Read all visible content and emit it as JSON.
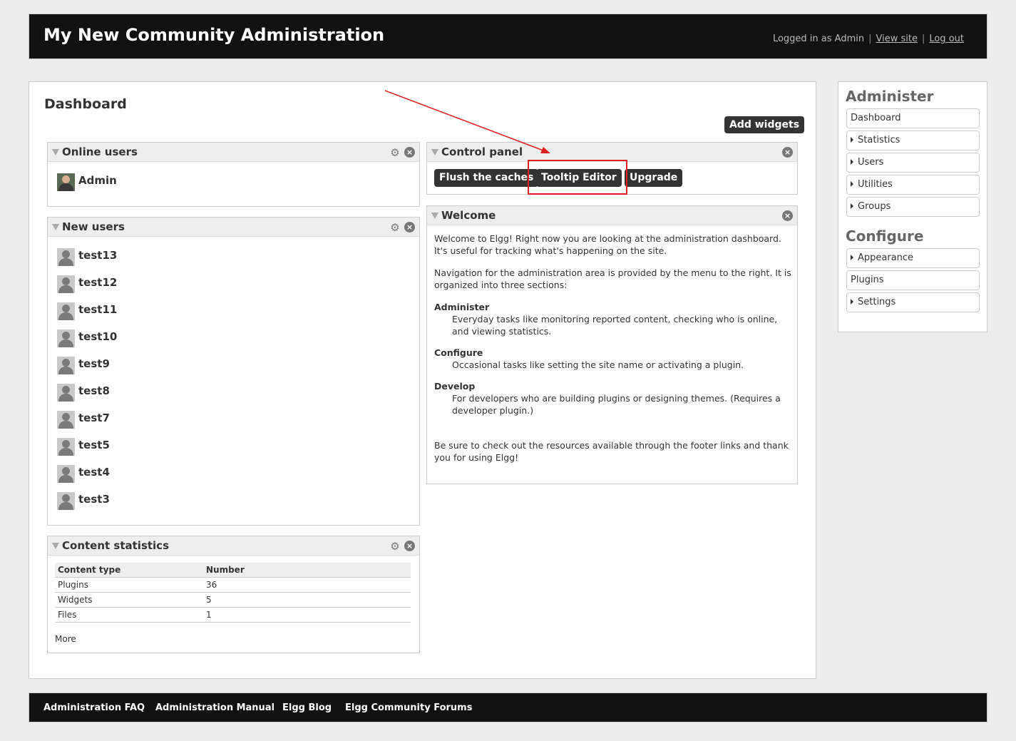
{
  "header": {
    "site_title": "My New Community Administration",
    "logged_in": "Logged in as Admin",
    "view_site": "View site",
    "log_out": "Log out"
  },
  "main": {
    "page_title": "Dashboard",
    "add_widgets": "Add widgets"
  },
  "widgets": {
    "online_users": {
      "title": "Online users",
      "users": [
        "Admin"
      ]
    },
    "new_users": {
      "title": "New users",
      "users": [
        "test13",
        "test12",
        "test11",
        "test10",
        "test9",
        "test8",
        "test7",
        "test5",
        "test4",
        "test3"
      ]
    },
    "content_statistics": {
      "title": "Content statistics",
      "headers": [
        "Content type",
        "Number"
      ],
      "rows": [
        [
          "Plugins",
          "36"
        ],
        [
          "Widgets",
          "5"
        ],
        [
          "Files",
          "1"
        ]
      ],
      "more": "More"
    },
    "control_panel": {
      "title": "Control panel",
      "buttons": [
        "Flush the caches",
        "Tooltip Editor",
        "Upgrade"
      ]
    },
    "welcome": {
      "title": "Welcome",
      "intro": "Welcome to Elgg! Right now you are looking at the administration dashboard. It's useful for tracking what's happening on the site.",
      "nav": "Navigation for the administration area is provided by the menu to the right. It is organized into three sections:",
      "sections": [
        {
          "term": "Administer",
          "desc": "Everyday tasks like monitoring reported content, checking who is online, and viewing statistics."
        },
        {
          "term": "Configure",
          "desc": "Occasional tasks like setting the site name or activating a plugin."
        },
        {
          "term": "Develop",
          "desc": "For developers who are building plugins or designing themes. (Requires a developer plugin.)"
        }
      ],
      "outro": "Be sure to check out the resources available through the footer links and thank you for using Elgg!"
    }
  },
  "sidebar": {
    "administer_title": "Administer",
    "administer_items": [
      "Dashboard",
      "Statistics",
      "Users",
      "Utilities",
      "Groups"
    ],
    "configure_title": "Configure",
    "configure_items": [
      "Appearance",
      "Plugins",
      "Settings"
    ]
  },
  "footer": {
    "links": [
      "Administration FAQ",
      "Administration Manual",
      "Elgg Blog",
      "Elgg Community Forums"
    ]
  },
  "colors": {
    "header_bg": "#111111",
    "button_bg": "#333333",
    "annotation_red": "#e02020"
  }
}
